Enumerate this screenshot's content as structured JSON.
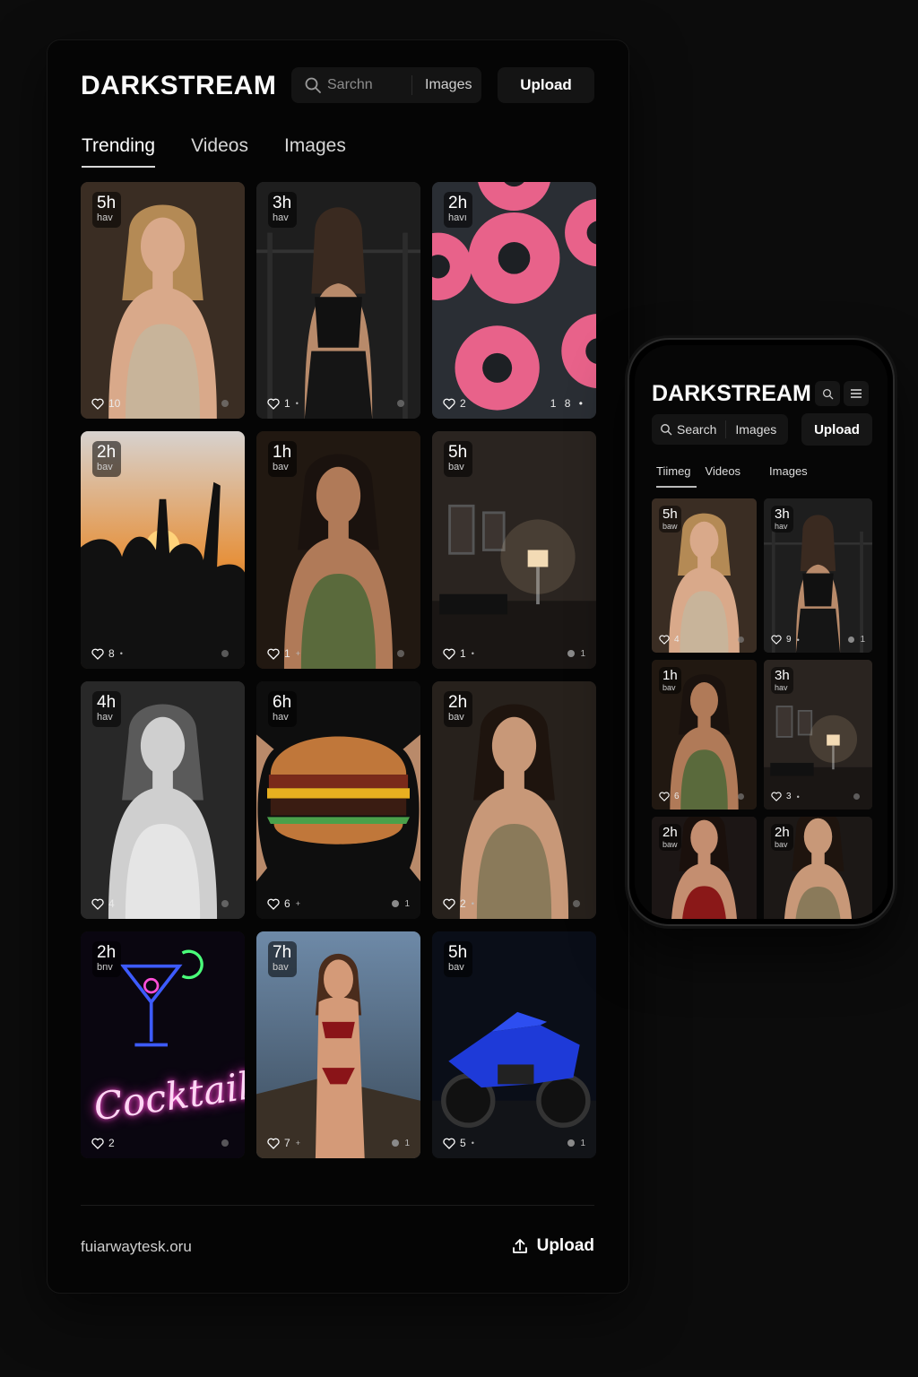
{
  "desktop": {
    "logo": "DARKSTREAM",
    "search": {
      "placeholder": "Sarchn",
      "scope": "Images"
    },
    "upload_label": "Upload",
    "tabs": [
      {
        "label": "Trending",
        "active": true
      },
      {
        "label": "Videos",
        "active": false
      },
      {
        "label": "Images",
        "active": false
      }
    ],
    "cards": [
      {
        "time": "5h",
        "sub": "hav",
        "likes": "10",
        "extra": "",
        "right": "",
        "subject": "woman in beige tank top portrait"
      },
      {
        "time": "3h",
        "sub": "hav",
        "likes": "1",
        "extra": "•",
        "right": "",
        "subject": "woman in gym from behind"
      },
      {
        "time": "2h",
        "sub": "havı",
        "likes": "2",
        "extra": "",
        "right": "1 8 •",
        "subject": "pink sprinkled donuts"
      },
      {
        "time": "2h",
        "sub": "bav",
        "likes": "8",
        "extra": "•",
        "right": "",
        "subject": "friends toasting beer at sunset"
      },
      {
        "time": "1h",
        "sub": "bav",
        "likes": "1",
        "extra": "+",
        "right": "",
        "subject": "smiling woman in saree with gold jewelry"
      },
      {
        "time": "5h",
        "sub": "bav",
        "likes": "1",
        "extra": "•",
        "right": "1",
        "subject": "dim room with lamp and frames"
      },
      {
        "time": "4h",
        "sub": "hav",
        "likes": "4",
        "extra": "",
        "right": "",
        "subject": "black and white woman portrait"
      },
      {
        "time": "6h",
        "sub": "hav",
        "likes": "6",
        "extra": "+",
        "right": "1",
        "subject": "hands holding cheeseburger"
      },
      {
        "time": "2h",
        "sub": "bav",
        "likes": "2",
        "extra": "•",
        "right": "",
        "subject": "young man in shirt portrait"
      },
      {
        "time": "2h",
        "sub": "bnv",
        "likes": "2",
        "extra": "",
        "right": "",
        "subject": "neon cocktails sign",
        "neon_text": "Cocktails"
      },
      {
        "time": "7h",
        "sub": "bav",
        "likes": "7",
        "extra": "+",
        "right": "1",
        "subject": "woman in red bikini on rocks"
      },
      {
        "time": "5h",
        "sub": "bav",
        "likes": "5",
        "extra": "•",
        "right": "1",
        "subject": "blue sport motorcycle"
      }
    ],
    "footer": {
      "url": "fuiarwaytesk.oru",
      "upload_label": "Upload"
    }
  },
  "mobile": {
    "logo": "DARKSTREAM",
    "search": {
      "placeholder": "Search",
      "scope": "Images"
    },
    "upload_label": "Upload",
    "tabs": [
      {
        "label": "Tiimeg",
        "active": true
      },
      {
        "label": "Videos",
        "active": false
      },
      {
        "label": "Images",
        "active": false
      }
    ],
    "cards": [
      {
        "time": "5h",
        "sub": "baw",
        "likes": "4",
        "extra": "",
        "right": ""
      },
      {
        "time": "3h",
        "sub": "hav",
        "likes": "9",
        "extra": "•",
        "right": "1"
      },
      {
        "time": "1h",
        "sub": "bav",
        "likes": "6",
        "extra": "",
        "right": ""
      },
      {
        "time": "3h",
        "sub": "hav",
        "likes": "3",
        "extra": "•",
        "right": ""
      },
      {
        "time": "2h",
        "sub": "baw",
        "likes": "",
        "extra": "",
        "right": ""
      },
      {
        "time": "2h",
        "sub": "bav",
        "likes": "",
        "extra": "",
        "right": ""
      }
    ]
  },
  "colors": {
    "background": "#0c0c0c",
    "panel": "#050505",
    "control": "#141414",
    "donut_pink": "#e8628a",
    "neon_pink": "#ff4fd8",
    "moto_blue": "#1e3ad8"
  },
  "icons": [
    "search-icon",
    "menu-icon",
    "heart-icon",
    "upload-icon"
  ]
}
